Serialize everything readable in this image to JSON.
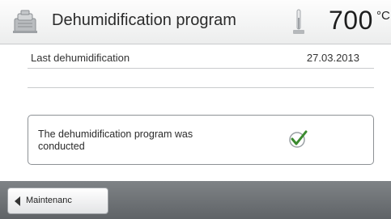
{
  "header": {
    "title": "Dehumidification program",
    "temperature": "700",
    "unit": "°C",
    "program_icon": "furnace-icon",
    "temperature_icon": "thermometer-icon"
  },
  "rows": [
    {
      "label": "Last dehumidification",
      "value": "27.03.2013"
    },
    {
      "label": "",
      "value": ""
    }
  ],
  "status": {
    "message": "The dehumidification program was conducted",
    "icon": "checkmark-icon",
    "check_color": "#3a8a2e"
  },
  "footer": {
    "back_label": "Maintenanc",
    "back_icon": "arrow-left-icon"
  },
  "colors": {
    "bottom_bar": "#6e7275",
    "header_bg": "#f4f5f5"
  }
}
